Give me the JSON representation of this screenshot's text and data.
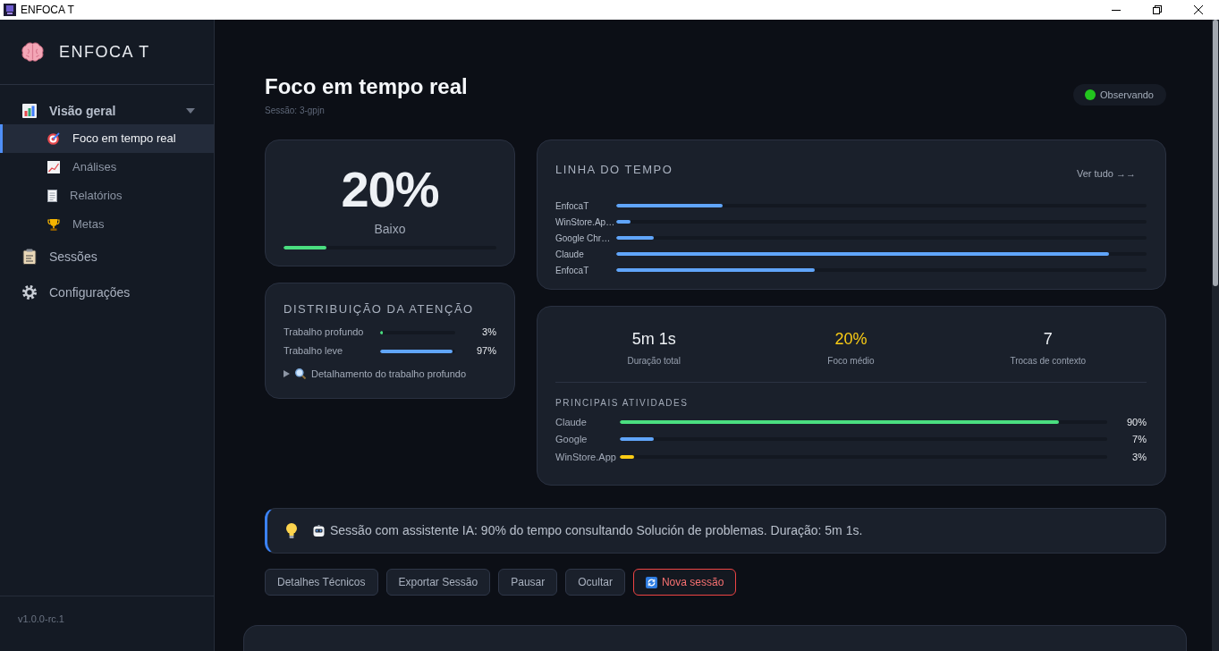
{
  "window": {
    "title": "ENFOCA T"
  },
  "sidebar": {
    "brand": "ENFOCA T",
    "items": [
      {
        "label": "Visão geral",
        "kind": "group",
        "selected": false,
        "expanded": true,
        "children": [
          {
            "label": "Foco em tempo real",
            "selected": true
          },
          {
            "label": "Análises",
            "selected": false
          },
          {
            "label": "Relatórios",
            "selected": false
          },
          {
            "label": "Metas",
            "selected": false
          }
        ]
      },
      {
        "label": "Sessões",
        "kind": "link",
        "selected": false
      },
      {
        "label": "Configurações",
        "kind": "link",
        "selected": false
      }
    ],
    "version": "v1.0.0-rc.1"
  },
  "header": {
    "title": "Foco em tempo real",
    "session": "Sessão: 3-gpjn",
    "status": {
      "label": "Observando",
      "active": true
    }
  },
  "focus_card": {
    "value": "20%",
    "label": "Baixo",
    "level": 0.2
  },
  "distribution": {
    "title": "DISTRIBUIÇÃO DA ATENÇÃO",
    "rows": [
      {
        "label": "Trabalho profundo",
        "level": 0.03,
        "reading": "3%",
        "color": "#4ade80"
      },
      {
        "label": "Trabalho leve",
        "level": 0.97,
        "reading": "97%",
        "color": "#60a5fa"
      }
    ],
    "details": {
      "label": "Detalhamento do trabalho profundo",
      "expanded": false
    }
  },
  "timeline": {
    "title": "LINHA DO TEMPO",
    "link": "Ver tudo →→",
    "rows": [
      {
        "label": "EnfocaT",
        "level": 0.2
      },
      {
        "label": "WinStore.Ap…",
        "level": 0.027
      },
      {
        "label": "Google Chr…",
        "level": 0.07
      },
      {
        "label": "Claude",
        "level": 0.93
      },
      {
        "label": "EnfocaT",
        "level": 0.375
      }
    ]
  },
  "summary": {
    "stats": [
      {
        "value": "5m 1s",
        "label": "Duração total",
        "highlighted": false
      },
      {
        "value": "20%",
        "label": "Foco médio",
        "highlighted": true
      },
      {
        "value": "7",
        "label": "Trocas de contexto",
        "highlighted": false
      }
    ],
    "activities_title": "PRINCIPAIS ATIVIDADES",
    "activities": [
      {
        "label": "Claude",
        "level": 0.9,
        "reading": "90%",
        "color": "#4ade80"
      },
      {
        "label": "Google",
        "level": 0.07,
        "reading": "7%",
        "color": "#60a5fa"
      },
      {
        "label": "WinStore.App",
        "level": 0.03,
        "reading": "3%",
        "color": "#facc15"
      }
    ]
  },
  "insight": {
    "text": "Sessão com assistente IA: 90% do tempo consultando Solución de problemas. Duração: 5m 1s."
  },
  "actions": [
    {
      "label": "Detalhes Técnicos",
      "kind": "default"
    },
    {
      "label": "Exportar Sessão",
      "kind": "default"
    },
    {
      "label": "Pausar",
      "kind": "default"
    },
    {
      "label": "Ocultar",
      "kind": "default"
    },
    {
      "label": "Nova sessão",
      "kind": "danger"
    }
  ]
}
